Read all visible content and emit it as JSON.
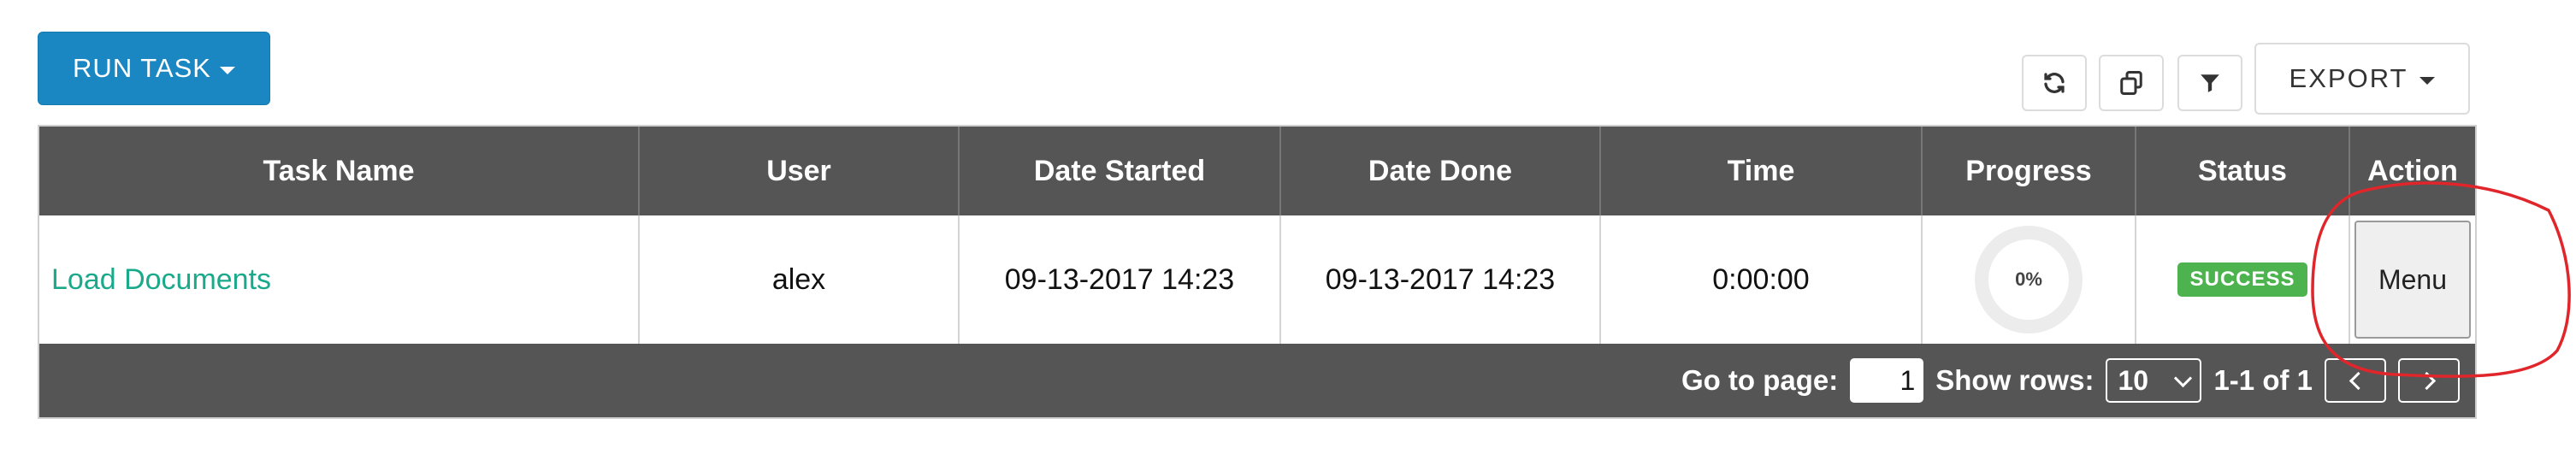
{
  "toolbar": {
    "run_task_label": "RUN TASK",
    "refresh_icon": "refresh-icon",
    "copy_icon": "copy-icon",
    "filter_icon": "filter-icon",
    "export_label": "EXPORT"
  },
  "table": {
    "columns": [
      "Task Name",
      "User",
      "Date Started",
      "Date Done",
      "Time",
      "Progress",
      "Status",
      "Action"
    ],
    "rows": [
      {
        "task_name": "Load Documents",
        "user": "alex",
        "date_started": "09-13-2017 14:23",
        "date_done": "09-13-2017 14:23",
        "time": "0:00:00",
        "progress_percent": 0,
        "progress_label": "0%",
        "status": "SUCCESS",
        "action_label": "Menu"
      }
    ]
  },
  "pagination": {
    "go_to_page_label": "Go to page:",
    "page_value": "1",
    "show_rows_label": "Show rows:",
    "rows_value": "10",
    "range_label": "1-1 of 1"
  },
  "colors": {
    "primary_button": "#1a87c2",
    "header_bg": "#555555",
    "link": "#1aaa8b",
    "success": "#4cb34f",
    "annotation": "#e0262b"
  }
}
